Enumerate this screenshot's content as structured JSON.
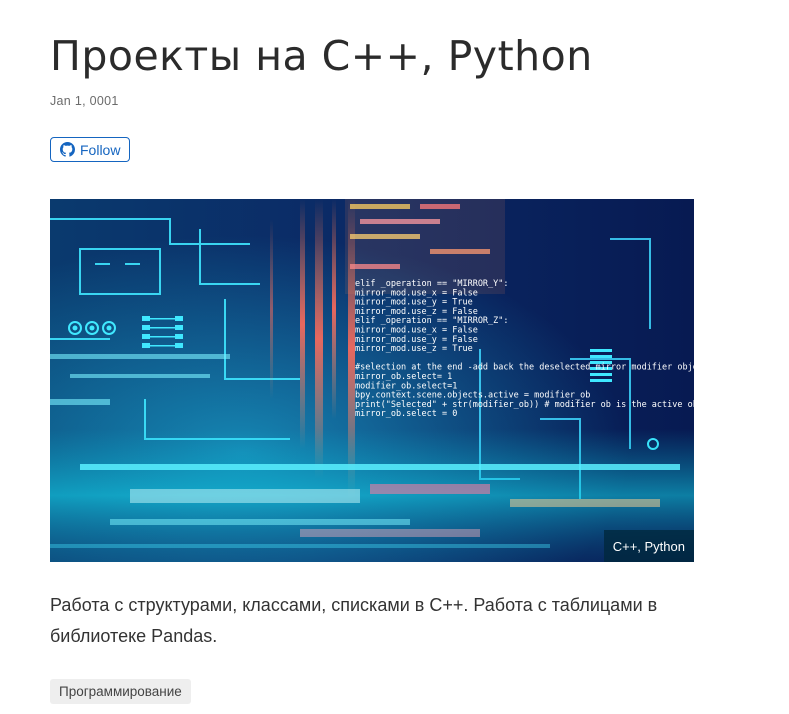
{
  "post": {
    "title": "Проекты на C++, Python",
    "date": "Jan 1, 0001",
    "follow_label": "Follow",
    "image_caption": "C++, Python",
    "summary": "Работа с структурами, классами, списками в C++. Работа с таблицами в библиотеке Pandas.",
    "tags": [
      "Программирование"
    ]
  },
  "hero_code_lines": [
    "elif _operation == \"MIRROR_Y\":",
    "    mirror_mod.use_x = False",
    "    mirror_mod.use_y = True",
    "    mirror_mod.use_z = False",
    "elif _operation == \"MIRROR_Z\":",
    "    mirror_mod.use_x = False",
    "    mirror_mod.use_y = False",
    "    mirror_mod.use_z = True",
    "",
    "#selection at the end -add back the deselected mirror modifier object",
    "mirror_ob.select= 1",
    "modifier_ob.select=1",
    "bpy.context.scene.objects.active = modifier_ob",
    "print(\"Selected\" + str(modifier_ob)) # modifier ob is the active ob",
    "    mirror_ob.select = 0"
  ],
  "colors": {
    "accent": "#1565c0",
    "title": "#2b2b2b",
    "hero_bg": "#081a4a",
    "tag_bg": "#eeeeee"
  },
  "icons": {
    "follow": "github-icon"
  }
}
